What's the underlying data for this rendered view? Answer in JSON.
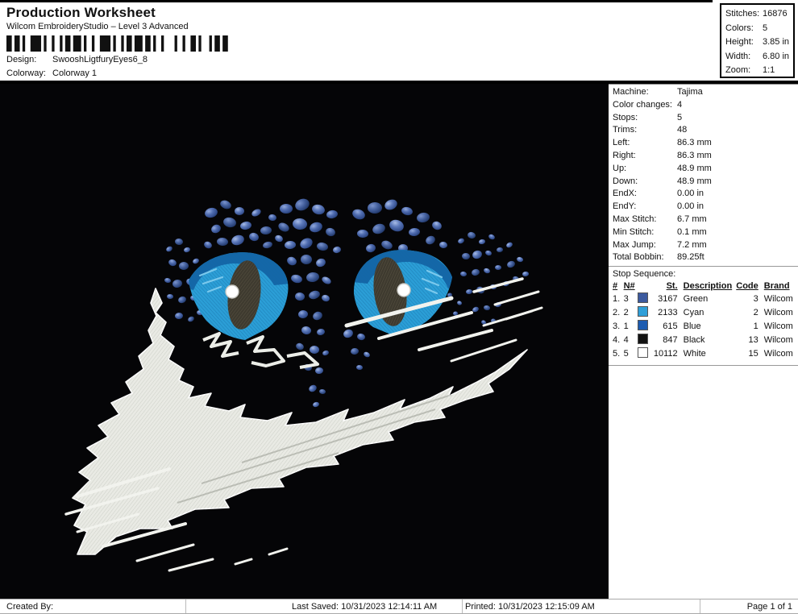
{
  "header": {
    "title": "Production Worksheet",
    "subtitle": "Wilcom EmbroideryStudio – Level 3 Advanced",
    "barcode_icon": "barcode",
    "design_label": "Design:",
    "design_value": "SwooshLigtfuryEyes6_8",
    "colorway_label": "Colorway:",
    "colorway_value": "Colorway 1"
  },
  "summary": {
    "rows": [
      {
        "label": "Stitches:",
        "value": "16876"
      },
      {
        "label": "Colors:",
        "value": "5"
      },
      {
        "label": "Height:",
        "value": "3.85 in"
      },
      {
        "label": "Width:",
        "value": "6.80 in"
      },
      {
        "label": "Zoom:",
        "value": "1:1"
      }
    ]
  },
  "machine_info": {
    "rows": [
      {
        "label": "Machine:",
        "value": "Tajima"
      },
      {
        "label": "Color changes:",
        "value": "4"
      },
      {
        "label": "Stops:",
        "value": "5"
      },
      {
        "label": "Trims:",
        "value": "48"
      },
      {
        "label": "Left:",
        "value": "86.3 mm"
      },
      {
        "label": "Right:",
        "value": "86.3 mm"
      },
      {
        "label": "Up:",
        "value": "48.9 mm"
      },
      {
        "label": "Down:",
        "value": "48.9 mm"
      },
      {
        "label": "EndX:",
        "value": "0.00 in"
      },
      {
        "label": "EndY:",
        "value": "0.00 in"
      },
      {
        "label": "Max Stitch:",
        "value": "6.7 mm"
      },
      {
        "label": "Min Stitch:",
        "value": "0.1 mm"
      },
      {
        "label": "Max Jump:",
        "value": "7.2 mm"
      },
      {
        "label": "Total Bobbin:",
        "value": "89.25ft"
      }
    ]
  },
  "stop_sequence": {
    "title": "Stop Sequence:",
    "columns": [
      "#",
      "N#",
      "St.",
      "Description",
      "Code",
      "Brand"
    ],
    "rows": [
      {
        "num": "1.",
        "n": "3",
        "swatch_color": "#3c5a9e",
        "st": "3167",
        "description": "Green",
        "code": "3",
        "brand": "Wilcom"
      },
      {
        "num": "2.",
        "n": "2",
        "swatch_color": "#2f9fd8",
        "st": "2133",
        "description": "Cyan",
        "code": "2",
        "brand": "Wilcom"
      },
      {
        "num": "3.",
        "n": "1",
        "swatch_color": "#1d5cb0",
        "st": "615",
        "description": "Blue",
        "code": "1",
        "brand": "Wilcom"
      },
      {
        "num": "4.",
        "n": "4",
        "swatch_color": "#121212",
        "st": "847",
        "description": "Black",
        "code": "13",
        "brand": "Wilcom"
      },
      {
        "num": "5.",
        "n": "5",
        "swatch_color": "#ffffff",
        "st": "10112",
        "description": "White",
        "code": "15",
        "brand": "Wilcom"
      }
    ]
  },
  "design_canvas": {
    "artwork": "night-fury-eyes-with-distressed-swoosh",
    "background_color": "#050507",
    "colors": {
      "scale_dot_blue": "#4f6cb0",
      "eye_cyan": "#2b9ed6",
      "eye_dark_band": "#1467a8",
      "pupil": "#3e3a2f",
      "swoosh_white": "#e9eae4"
    }
  },
  "footer": {
    "created_by": "Created By:",
    "last_saved": "Last Saved: 10/31/2023 12:14:11 AM",
    "printed": "Printed: 10/31/2023 12:15:09 AM",
    "page": "Page 1 of 1"
  }
}
